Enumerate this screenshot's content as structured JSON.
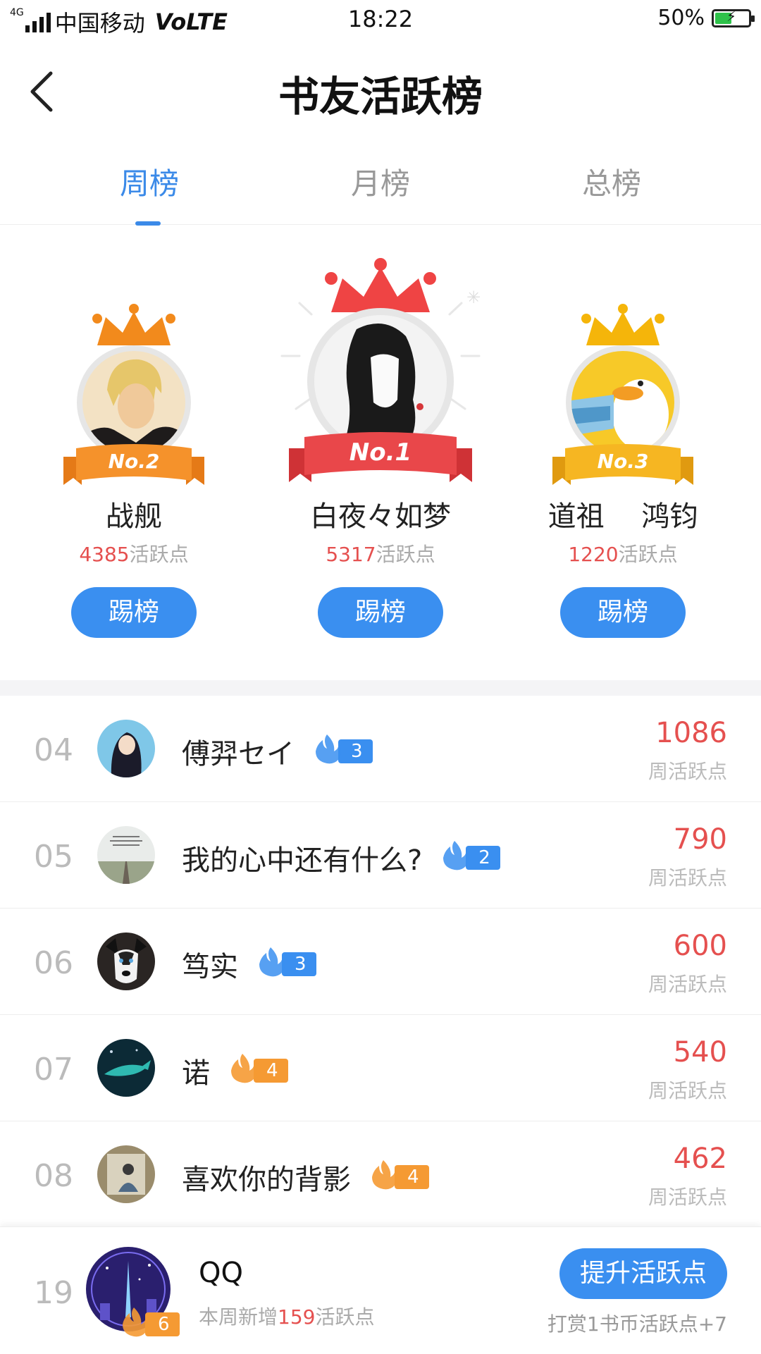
{
  "status_bar": {
    "network": "4G",
    "carrier": "中国移动",
    "volte": "VoLTE",
    "time": "18:22",
    "battery": "50%",
    "battery_level": 0.5
  },
  "header": {
    "title": "书友活跃榜"
  },
  "tabs": [
    {
      "label": "周榜",
      "active": true
    },
    {
      "label": "月榜",
      "active": false
    },
    {
      "label": "总榜",
      "active": false
    }
  ],
  "podium": {
    "first": {
      "badge": "No.1",
      "name": "白夜々如梦",
      "points": "5317",
      "points_suffix": "活跃点",
      "button": "踢榜",
      "crown_color": "#ef4444",
      "ribbon_color": "#e9474a"
    },
    "second": {
      "badge": "No.2",
      "name": "战舰",
      "points": "4385",
      "points_suffix": "活跃点",
      "button": "踢榜",
      "crown_color": "#f28a1c",
      "ribbon_color": "#f5922b"
    },
    "third": {
      "badge": "No.3",
      "name": "道祖　 鸿钧",
      "points": "1220",
      "points_suffix": "活跃点",
      "button": "踢榜",
      "crown_color": "#f5b50a",
      "ribbon_color": "#f6b622"
    }
  },
  "list": [
    {
      "rank": "04",
      "name": "傅羿セイ",
      "level": "3",
      "level_color": "blue",
      "score": "1086",
      "score_label": "周活跃点"
    },
    {
      "rank": "05",
      "name": "我的心中还有什么?",
      "level": "2",
      "level_color": "blue",
      "score": "790",
      "score_label": "周活跃点"
    },
    {
      "rank": "06",
      "name": "笃实",
      "level": "3",
      "level_color": "blue",
      "score": "600",
      "score_label": "周活跃点"
    },
    {
      "rank": "07",
      "name": "诺",
      "level": "4",
      "level_color": "orange",
      "score": "540",
      "score_label": "周活跃点"
    },
    {
      "rank": "08",
      "name": "喜欢你的背影",
      "level": "4",
      "level_color": "orange",
      "score": "462",
      "score_label": "周活跃点"
    }
  ],
  "self": {
    "rank": "19",
    "name": "QQ",
    "level": "6",
    "week_prefix": "本周新增",
    "week_points": "159",
    "week_suffix": "活跃点",
    "button": "提升活跃点",
    "tip": "打赏1书币活跃点+7"
  }
}
